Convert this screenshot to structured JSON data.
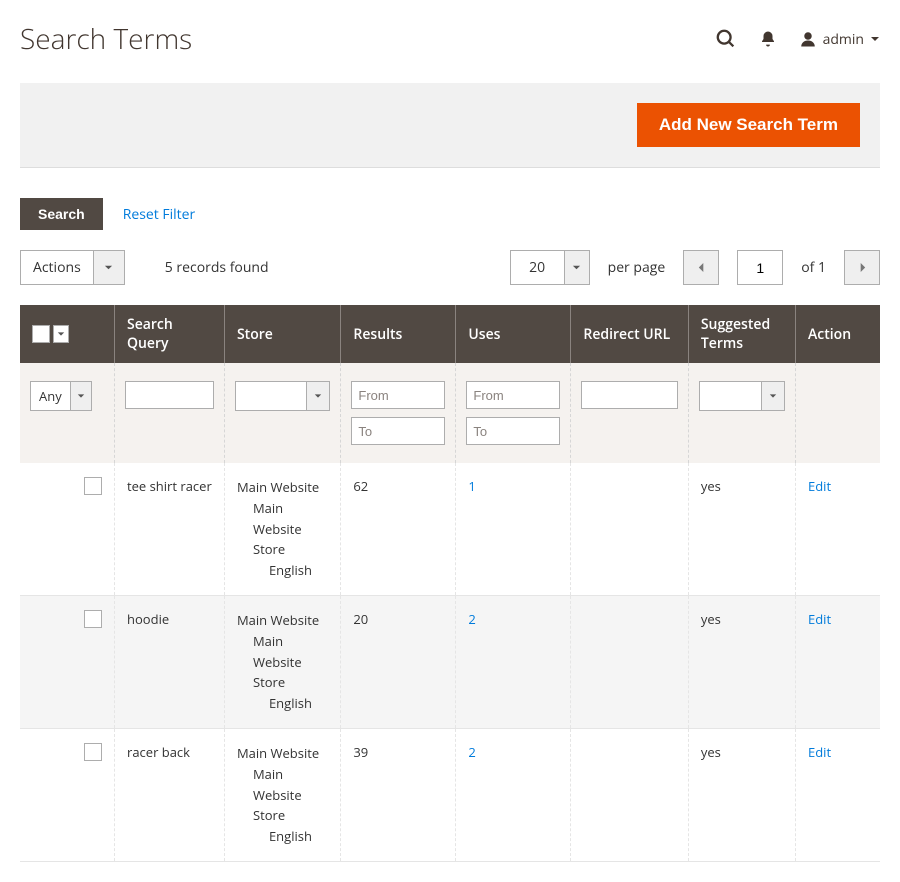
{
  "header": {
    "page_title": "Search Terms",
    "user_label": "admin"
  },
  "action_bar": {
    "add_btn": "Add New Search Term"
  },
  "controls": {
    "search_btn": "Search",
    "reset_filter": "Reset Filter",
    "actions_label": "Actions",
    "records_found": "5 records found",
    "per_page_value": "20",
    "per_page_label": "per page",
    "page_current": "1",
    "page_of": "of 1"
  },
  "columns": {
    "search_query": "Search Query",
    "store": "Store",
    "results": "Results",
    "uses": "Uses",
    "redirect_url": "Redirect URL",
    "suggested_terms": "Suggested Terms",
    "action": "Action"
  },
  "filters": {
    "any_label": "Any",
    "from_ph": "From",
    "to_ph": "To"
  },
  "rows": [
    {
      "query": "tee shirt racer",
      "store_l1": "Main Website",
      "store_l2": "Main Website Store",
      "store_l3": "English",
      "results": "62",
      "uses": "1",
      "redirect": "",
      "suggested": "yes",
      "action": "Edit"
    },
    {
      "query": "hoodie",
      "store_l1": "Main Website",
      "store_l2": "Main Website Store",
      "store_l3": "English",
      "results": "20",
      "uses": "2",
      "redirect": "",
      "suggested": "yes",
      "action": "Edit"
    },
    {
      "query": "racer back",
      "store_l1": "Main Website",
      "store_l2": "Main Website Store",
      "store_l3": "English",
      "results": "39",
      "uses": "2",
      "redirect": "",
      "suggested": "yes",
      "action": "Edit"
    }
  ]
}
